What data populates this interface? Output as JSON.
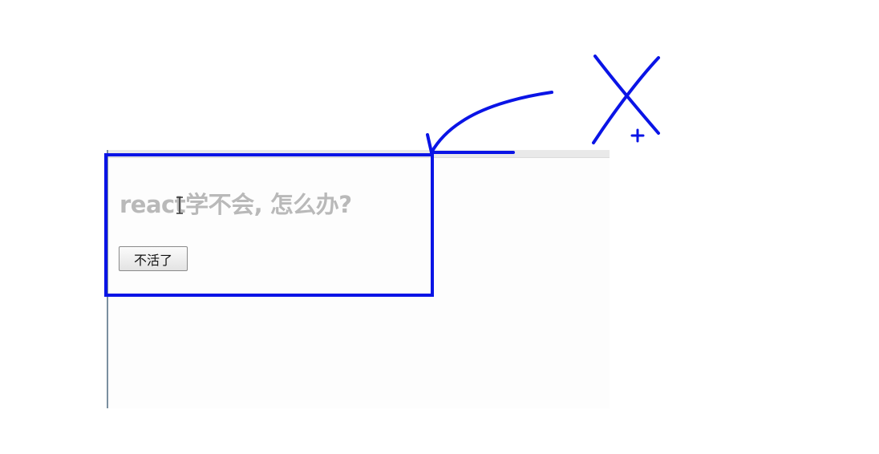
{
  "page": {
    "heading": "react学不会, 怎么办?",
    "button_label": "不活了"
  },
  "annotation": {
    "stroke_color": "#0a14e6",
    "cross_mark": "X",
    "plus_mark": "+"
  },
  "colors": {
    "heading_text": "#b9b9b9",
    "viewport_background": "#fdfdfd"
  }
}
